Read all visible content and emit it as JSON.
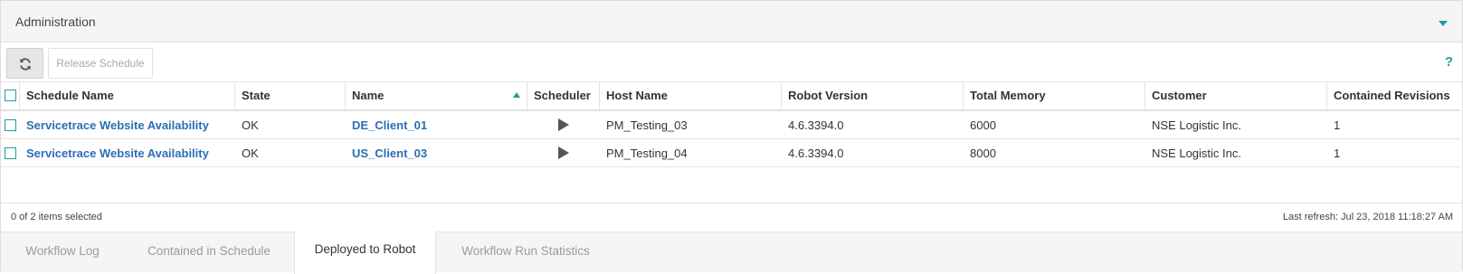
{
  "panel": {
    "title": "Administration"
  },
  "toolbar": {
    "refresh_icon": "refresh-icon",
    "release_schedule_label": "Release Schedule",
    "help_label": "?"
  },
  "grid": {
    "columns": [
      "Schedule Name",
      "State",
      "Name",
      "Scheduler",
      "Host Name",
      "Robot Version",
      "Total Memory",
      "Customer",
      "Contained Revisions"
    ],
    "sorted_column": "Name",
    "sort_direction": "ascending",
    "rows": [
      {
        "schedule_name": "Servicetrace Website Availability",
        "state": "OK",
        "name": "DE_Client_01",
        "scheduler_icon": "play-icon",
        "host_name": "PM_Testing_03",
        "robot_version": "4.6.3394.0",
        "total_memory": "6000",
        "customer": "NSE Logistic Inc.",
        "contained_revisions": "1"
      },
      {
        "schedule_name": "Servicetrace Website Availability",
        "state": "OK",
        "name": "US_Client_03",
        "scheduler_icon": "play-icon",
        "host_name": "PM_Testing_04",
        "robot_version": "4.6.3394.0",
        "total_memory": "8000",
        "customer": "NSE Logistic Inc.",
        "contained_revisions": "1"
      }
    ]
  },
  "status": {
    "selected_count": "0 of 2 items selected",
    "last_refresh": "Last refresh: Jul 23, 2018 11:18:27 AM"
  },
  "tabs": [
    {
      "label": "Workflow Log",
      "active": false
    },
    {
      "label": "Contained in Schedule",
      "active": false
    },
    {
      "label": "Deployed to Robot",
      "active": true
    },
    {
      "label": "Workflow Run Statistics",
      "active": false
    }
  ],
  "colors": {
    "accent": "#1f9e9a",
    "link": "#2e6db4",
    "header_bg": "#f5f5f5",
    "border": "#e3e3e3"
  }
}
